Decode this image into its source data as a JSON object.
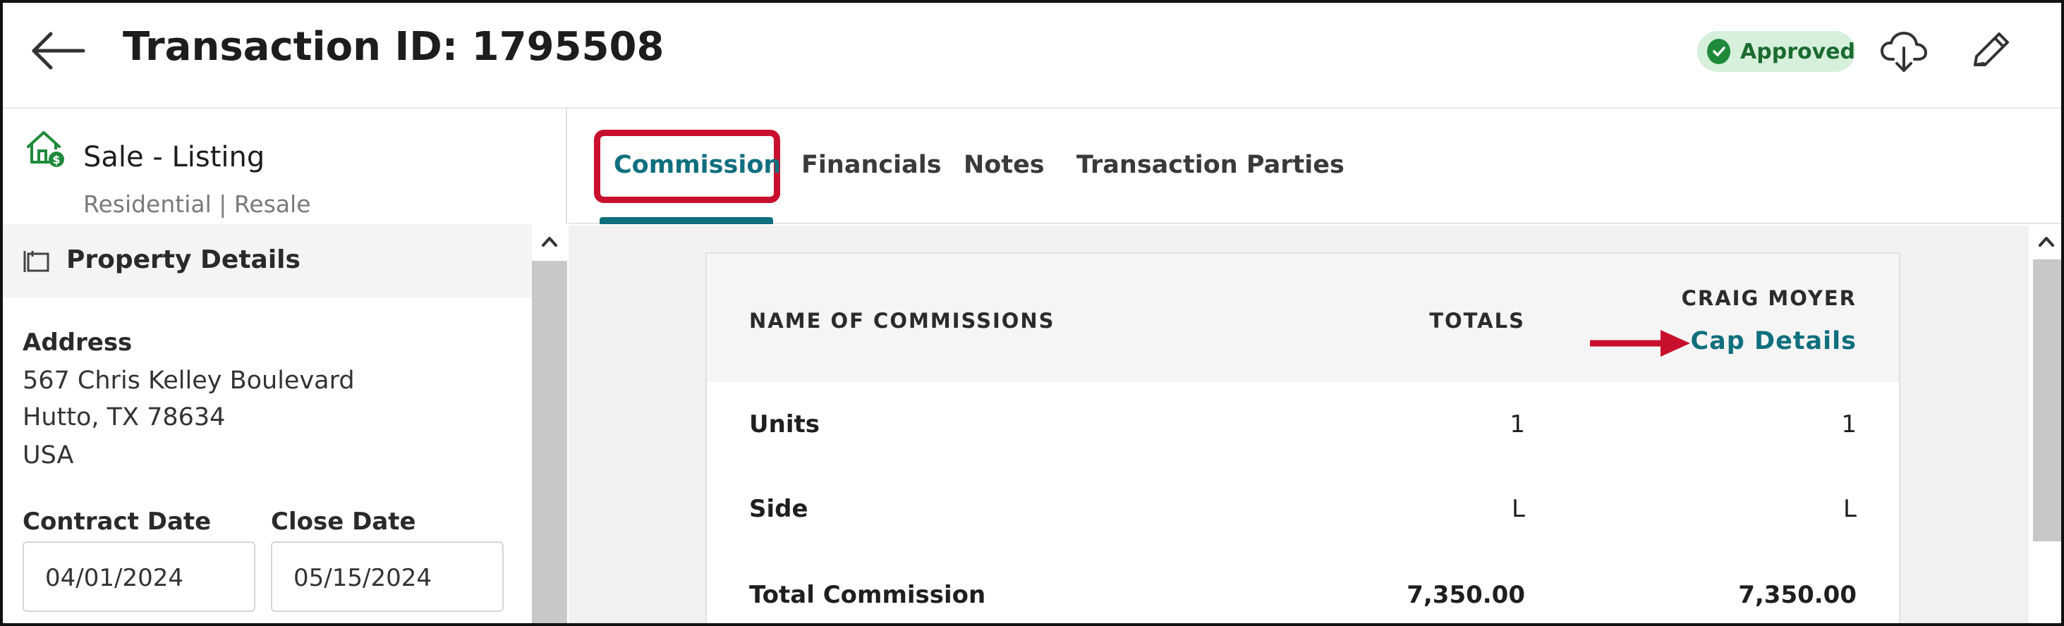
{
  "header": {
    "title": "Transaction ID: 1795508",
    "status": "Approved",
    "back_icon": "arrow-left-icon",
    "download_icon": "cloud-download-icon",
    "edit_icon": "pencil-icon"
  },
  "listing": {
    "type": "Sale - Listing",
    "subtype": "Residential | Resale",
    "icon": "house-dollar-icon"
  },
  "property": {
    "section_title": "Property Details",
    "address_label": "Address",
    "address_lines": [
      "567 Chris Kelley Boulevard",
      "Hutto, TX 78634",
      "USA"
    ],
    "contract_date_label": "Contract Date",
    "contract_date": "04/01/2024",
    "close_date_label": "Close Date",
    "close_date": "05/15/2024"
  },
  "tabs": [
    {
      "label": "Commission",
      "active": true
    },
    {
      "label": "Financials",
      "active": false
    },
    {
      "label": "Notes",
      "active": false
    },
    {
      "label": "Transaction Parties",
      "active": false
    }
  ],
  "commission_table": {
    "columns": {
      "name": "NAME OF COMMISSIONS",
      "totals": "TOTALS",
      "agent": "CRAIG MOYER",
      "agent_link": "Cap Details"
    },
    "rows": [
      {
        "name": "Units",
        "total": "1",
        "agent": "1"
      },
      {
        "name": "Side",
        "total": "L",
        "agent": "L"
      },
      {
        "name": "Total Commission",
        "total": "7,350.00",
        "agent": "7,350.00"
      }
    ]
  },
  "colors": {
    "accent": "#0f6f7e",
    "highlight": "#c8102e",
    "approved_bg": "#d6f0dc",
    "approved_icon": "#1f8a3b"
  }
}
